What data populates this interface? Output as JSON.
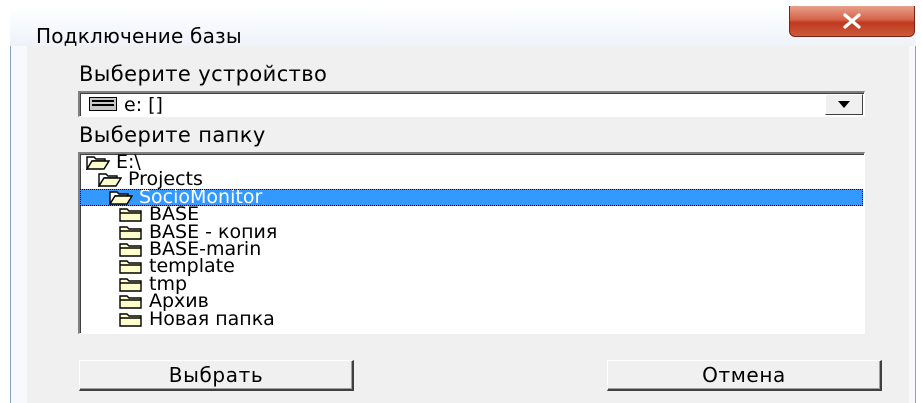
{
  "window": {
    "title": "Подключение базы",
    "close_icon": "close-icon",
    "close_color": "#c0391f"
  },
  "device": {
    "label": "Выберите устройство",
    "selected": "e: []",
    "icon": "drive-icon"
  },
  "folder": {
    "label": "Выберите папку",
    "items": [
      {
        "name": "E:\\",
        "icon": "open-folder-icon",
        "level": 0,
        "selected": false
      },
      {
        "name": "Projects",
        "icon": "open-folder-icon",
        "level": 1,
        "selected": false
      },
      {
        "name": "SocioMonitor",
        "icon": "open-folder-icon",
        "level": 2,
        "selected": true
      },
      {
        "name": "BASE",
        "icon": "folder-icon",
        "level": 3,
        "selected": false
      },
      {
        "name": "BASE - копия",
        "icon": "folder-icon",
        "level": 3,
        "selected": false
      },
      {
        "name": "BASE-marin",
        "icon": "folder-icon",
        "level": 3,
        "selected": false
      },
      {
        "name": "template",
        "icon": "folder-icon",
        "level": 3,
        "selected": false
      },
      {
        "name": "tmp",
        "icon": "folder-icon",
        "level": 3,
        "selected": false
      },
      {
        "name": "Архив",
        "icon": "folder-icon",
        "level": 3,
        "selected": false
      },
      {
        "name": "Новая папка",
        "icon": "folder-icon",
        "level": 3,
        "selected": false
      }
    ],
    "selection_color": "#3399ff"
  },
  "buttons": {
    "select_label": "Выбрать",
    "cancel_label": "Отмена"
  }
}
